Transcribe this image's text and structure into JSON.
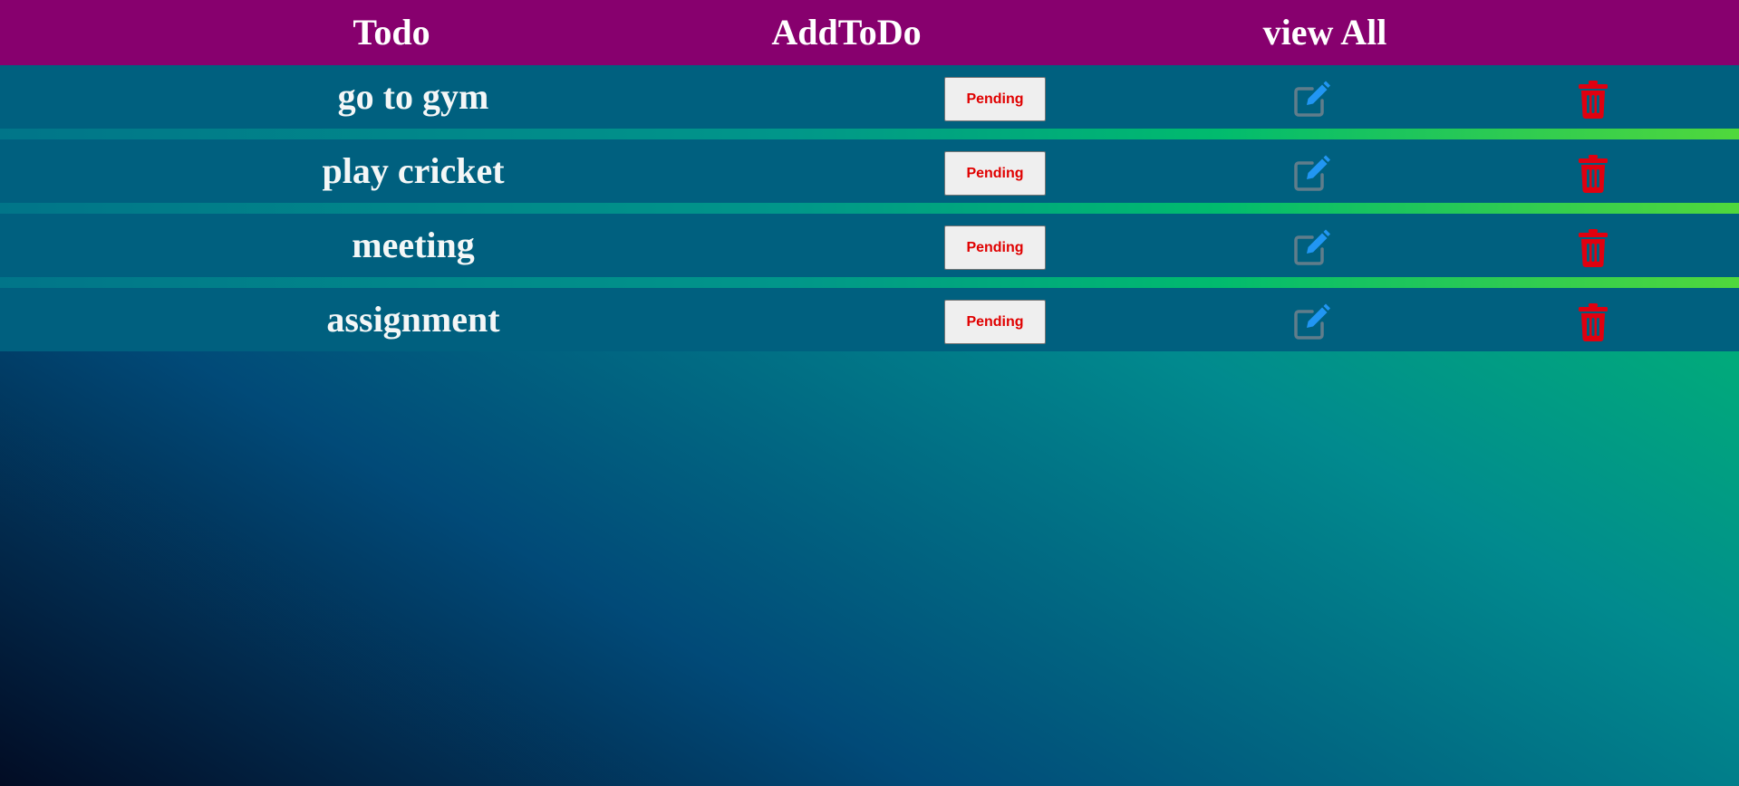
{
  "nav": {
    "todo_label": "Todo",
    "add_label": "AddToDo",
    "view_label": "view All"
  },
  "todos": [
    {
      "title": "go to gym",
      "status": "Pending"
    },
    {
      "title": "play cricket",
      "status": "Pending"
    },
    {
      "title": "meeting",
      "status": "Pending"
    },
    {
      "title": "assignment",
      "status": "Pending"
    }
  ],
  "icons": {
    "edit": "edit-icon",
    "delete": "trash-icon"
  },
  "colors": {
    "navbar": "#87006e",
    "row": "#00607f",
    "status_text": "#e00000",
    "edit_icon_pencil": "#2196f3",
    "edit_icon_box": "#607d8b",
    "delete_icon": "#e0000f"
  }
}
